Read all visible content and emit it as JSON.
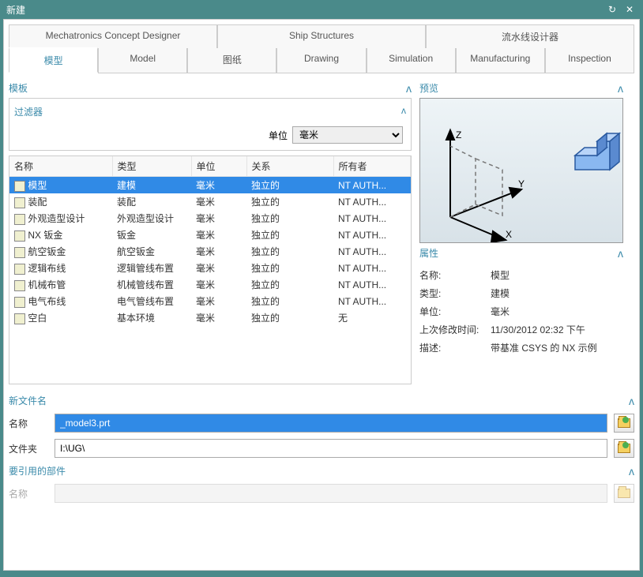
{
  "window": {
    "title": "新建"
  },
  "upperTabs": [
    "Mechatronics Concept Designer",
    "Ship Structures",
    "流水线设计器"
  ],
  "subTabs": [
    "模型",
    "Model",
    "图纸",
    "Drawing",
    "Simulation",
    "Manufacturing",
    "Inspection"
  ],
  "template": {
    "label": "模板",
    "filterLabel": "过滤器",
    "unitLabel": "单位",
    "unitValue": "毫米",
    "headers": {
      "name": "名称",
      "type": "类型",
      "unit": "单位",
      "relation": "关系",
      "owner": "所有者"
    },
    "rows": [
      {
        "name": "模型",
        "type": "建模",
        "unit": "毫米",
        "rel": "独立的",
        "owner": "NT AUTH...",
        "sel": true
      },
      {
        "name": "装配",
        "type": "装配",
        "unit": "毫米",
        "rel": "独立的",
        "owner": "NT AUTH..."
      },
      {
        "name": "外观造型设计",
        "type": "外观造型设计",
        "unit": "毫米",
        "rel": "独立的",
        "owner": "NT AUTH..."
      },
      {
        "name": "NX 钣金",
        "type": "钣金",
        "unit": "毫米",
        "rel": "独立的",
        "owner": "NT AUTH..."
      },
      {
        "name": "航空钣金",
        "type": "航空钣金",
        "unit": "毫米",
        "rel": "独立的",
        "owner": "NT AUTH..."
      },
      {
        "name": "逻辑布线",
        "type": "逻辑管线布置",
        "unit": "毫米",
        "rel": "独立的",
        "owner": "NT AUTH..."
      },
      {
        "name": "机械布管",
        "type": "机械管线布置",
        "unit": "毫米",
        "rel": "独立的",
        "owner": "NT AUTH..."
      },
      {
        "name": "电气布线",
        "type": "电气管线布置",
        "unit": "毫米",
        "rel": "独立的",
        "owner": "NT AUTH..."
      },
      {
        "name": "空白",
        "type": "基本环境",
        "unit": "毫米",
        "rel": "独立的",
        "owner": "无"
      }
    ]
  },
  "preview": {
    "label": "预览"
  },
  "properties": {
    "label": "属性",
    "rows": {
      "nameK": "名称:",
      "nameV": "模型",
      "typeK": "类型:",
      "typeV": "建模",
      "unitK": "单位:",
      "unitV": "毫米",
      "modK": "上次修改时间:",
      "modV": "11/30/2012 02:32 下午",
      "descK": "描述:",
      "descV": "带基准 CSYS 的 NX 示例"
    }
  },
  "newFile": {
    "label": "新文件名",
    "nameLabel": "名称",
    "nameValue": "_model3.prt",
    "folderLabel": "文件夹",
    "folderValue": "I:\\UG\\"
  },
  "refParts": {
    "label": "要引用的部件",
    "nameLabel": "名称"
  }
}
